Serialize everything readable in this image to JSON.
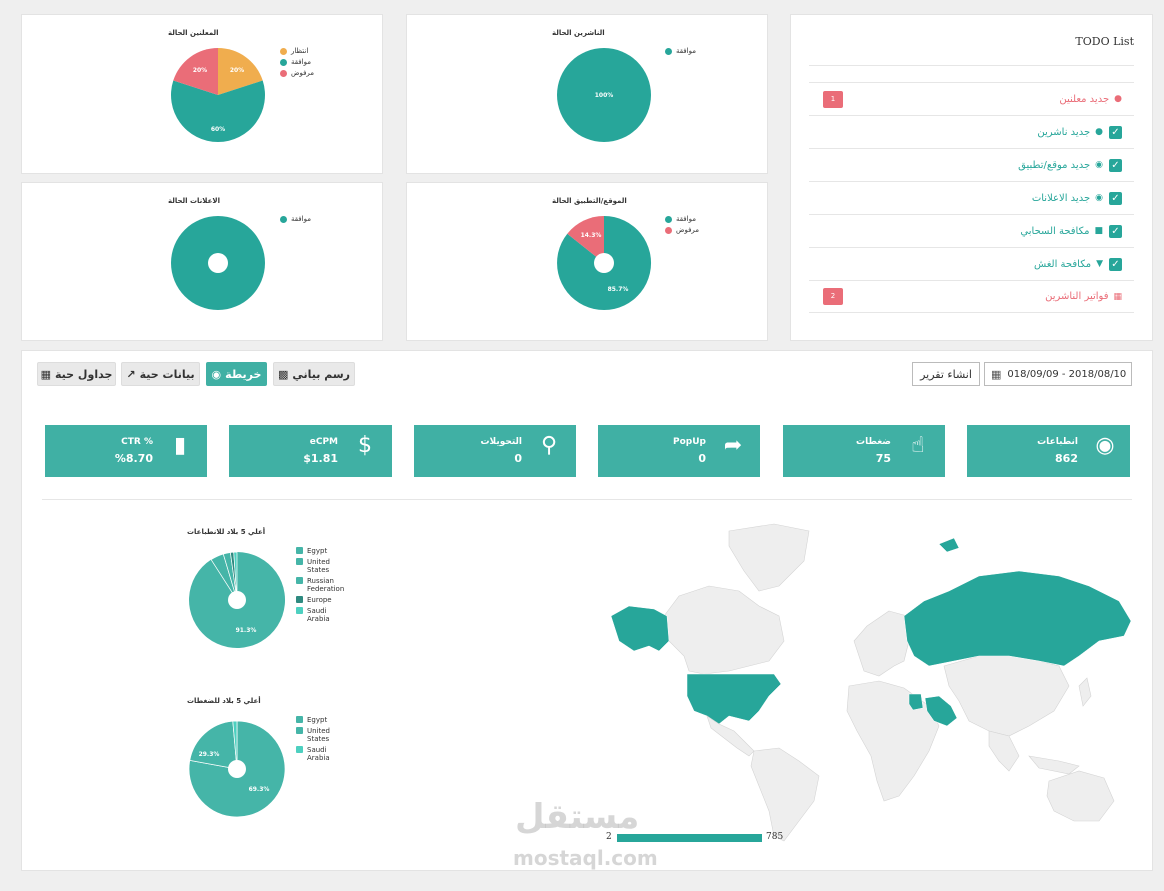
{
  "charts": {
    "advertisers": {
      "title": "المعلنين الحالة",
      "legend": [
        {
          "label": "انتظار",
          "color": "#f0ad4e"
        },
        {
          "label": "موافقة",
          "color": "#27a69a"
        },
        {
          "label": "مرفوض",
          "color": "#ea6d78"
        }
      ],
      "labels": [
        "20%",
        "60%",
        "20%"
      ]
    },
    "publishers": {
      "title": "الناشرين الحالة",
      "legend": [
        {
          "label": "موافقة",
          "color": "#27a69a"
        }
      ],
      "labels": [
        "100%"
      ]
    },
    "ads": {
      "title": "الاعلانات الحالة",
      "legend": [
        {
          "label": "موافقة",
          "color": "#27a69a"
        }
      ]
    },
    "sites": {
      "title": "الموقع/التطبيق الحالة",
      "legend": [
        {
          "label": "موافقة",
          "color": "#27a69a"
        },
        {
          "label": "مرفوض",
          "color": "#ea6d78"
        }
      ],
      "labels": [
        "85.7%",
        "14.3%"
      ]
    }
  },
  "chart_data": [
    {
      "type": "pie",
      "title": "المعلنين الحالة",
      "categories": [
        "انتظار",
        "موافقة",
        "مرفوض"
      ],
      "values": [
        20,
        60,
        20
      ]
    },
    {
      "type": "pie",
      "title": "الناشرين الحالة",
      "categories": [
        "موافقة"
      ],
      "values": [
        100
      ]
    },
    {
      "type": "pie",
      "title": "الاعلانات الحالة",
      "categories": [
        "موافقة"
      ],
      "values": [
        100
      ]
    },
    {
      "type": "pie",
      "title": "الموقع/التطبيق الحالة",
      "categories": [
        "موافقة",
        "مرفوض"
      ],
      "values": [
        85.7,
        14.3
      ]
    },
    {
      "type": "pie",
      "title": "أعلي 5 بلاد للانطباعات",
      "categories": [
        "Egypt",
        "United States",
        "Russian Federation",
        "Europe",
        "Saudi Arabia"
      ],
      "values": [
        91.3,
        4.3,
        2.2,
        1.1,
        1.1
      ]
    },
    {
      "type": "pie",
      "title": "أعلي 5 بلاد للضغطات",
      "categories": [
        "Egypt",
        "United States",
        "Saudi Arabia"
      ],
      "values": [
        69.3,
        29.3,
        1.4
      ]
    }
  ],
  "todo": {
    "title": "TODO List",
    "items": [
      {
        "label": "جديد معلنين",
        "icon": "user-icon",
        "status": "badge",
        "badge": "1"
      },
      {
        "label": "جديد ناشرين",
        "icon": "users-icon",
        "status": "check"
      },
      {
        "label": "جديد موقع/تطبيق",
        "icon": "globe-icon",
        "status": "check"
      },
      {
        "label": "جديد الاعلانات",
        "icon": "globe-icon",
        "status": "check"
      },
      {
        "label": "مكافحة السحابي",
        "icon": "lock-icon",
        "status": "check"
      },
      {
        "label": "مكافحة الغش",
        "icon": "shield-icon",
        "status": "check"
      },
      {
        "label": "فواتير الناشرين",
        "icon": "calculator-icon",
        "status": "badge",
        "badge": "2"
      }
    ]
  },
  "tabs": {
    "live_tables": "جداول حية",
    "live_data": "بيانات حية",
    "map": "خريطة",
    "chart": "رسم بياني"
  },
  "report_button": "انشاء تقرير",
  "date_range": "018/09/09 - 2018/08/10",
  "stats": [
    {
      "title": "انطباعات",
      "value": "862",
      "icon": "eye-icon"
    },
    {
      "title": "ضغطات",
      "value": "75",
      "icon": "pointer-icon"
    },
    {
      "title": "PopUp",
      "value": "0",
      "icon": "share-arrow-icon"
    },
    {
      "title": "التحويلات",
      "value": "0",
      "icon": "share-icon"
    },
    {
      "title": "eCPM",
      "value": "$1.81",
      "icon": "dollar-icon"
    },
    {
      "title": "CTR %",
      "value": "%8.70",
      "icon": "signal-icon"
    }
  ],
  "country_charts": {
    "impressions": {
      "title": "أعلي 5 بلاد للانطباعات",
      "legend": [
        {
          "label": "Egypt",
          "color": "#45b5a8"
        },
        {
          "label": "United States",
          "color": "#45b5a8"
        },
        {
          "label": "Russian Federation",
          "color": "#45b5a8"
        },
        {
          "label": "Europe",
          "color": "#2e8a80"
        },
        {
          "label": "Saudi Arabia",
          "color": "#4dd0c0"
        }
      ],
      "labels": [
        "91.3%"
      ]
    },
    "clicks": {
      "title": "أعلي 5 بلاد للضغطات",
      "legend": [
        {
          "label": "Egypt",
          "color": "#45b5a8"
        },
        {
          "label": "United States",
          "color": "#45b5a8"
        },
        {
          "label": "Saudi Arabia",
          "color": "#4dd0c0"
        }
      ],
      "labels": [
        "69.3%",
        "29.3%"
      ]
    }
  },
  "map_scale": {
    "min": "2",
    "max": "785"
  },
  "watermark": {
    "arabic": "مستقل",
    "latin": "mostaql.com"
  }
}
